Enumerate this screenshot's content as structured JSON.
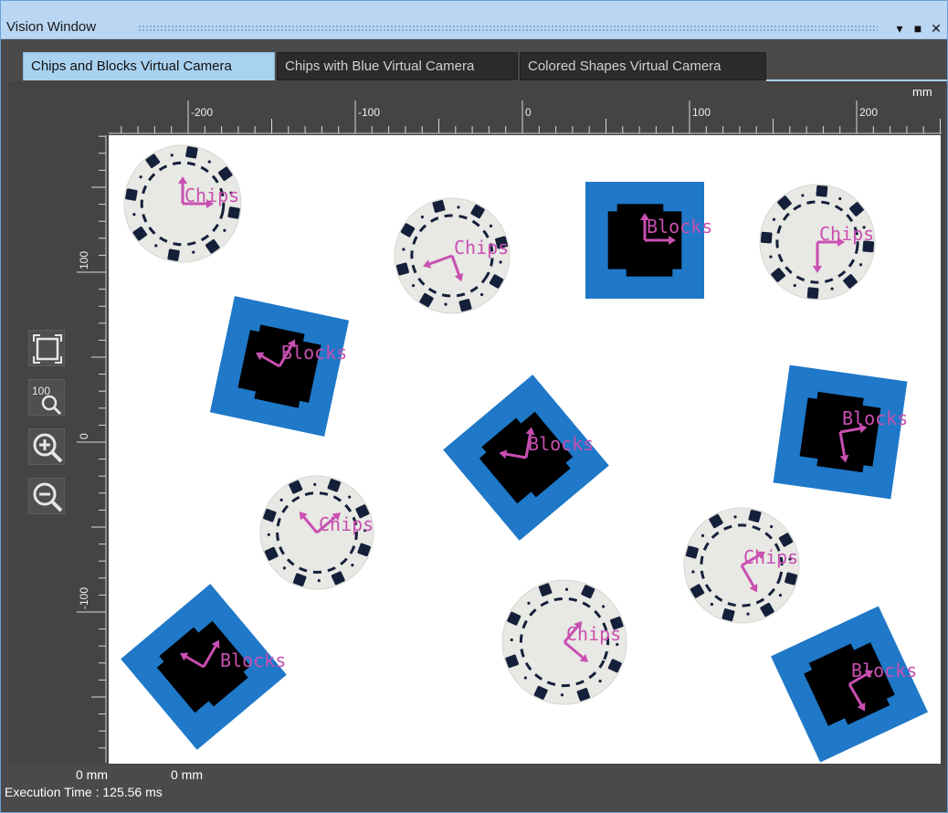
{
  "window": {
    "title": "Vision Window",
    "buttons": [
      {
        "name": "pin-icon",
        "glyph": "▾"
      },
      {
        "name": "maximize-icon",
        "glyph": "■"
      },
      {
        "name": "close-icon",
        "glyph": "✕"
      }
    ]
  },
  "tabs": [
    {
      "label": "Chips and Blocks Virtual Camera",
      "active": true
    },
    {
      "label": "Chips with Blue Virtual Camera",
      "active": false
    },
    {
      "label": "Colored Shapes Virtual Camera",
      "active": false
    }
  ],
  "ruler": {
    "unit": "mm",
    "h_labels": [
      "-200",
      "-100",
      "0",
      "100",
      "200"
    ],
    "v_labels": [
      "100",
      "0",
      "-100"
    ]
  },
  "tools": [
    {
      "name": "fit-to-window-icon"
    },
    {
      "name": "zoom-100-icon",
      "text": "100"
    },
    {
      "name": "zoom-in-icon"
    },
    {
      "name": "zoom-out-icon"
    }
  ],
  "status": {
    "x_coord": "0 mm",
    "y_coord": "0 mm",
    "exec_time": "Execution Time : 125.56 ms"
  },
  "colors": {
    "tab_active": "#a9d2f0",
    "block_blue": "#1f78c8",
    "label_magenta": "#c94fb1",
    "chip_white": "#e8e8e4",
    "chip_navy": "#14203a"
  },
  "objects": {
    "chip_label": "Chips",
    "block_label": "Blocks"
  }
}
